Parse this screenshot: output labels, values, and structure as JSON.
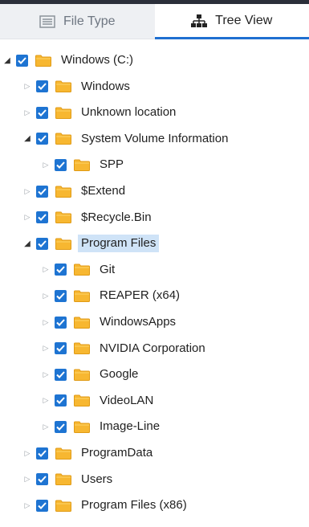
{
  "tabs": [
    {
      "label": "File Type",
      "icon": "list-icon",
      "active": false
    },
    {
      "label": "Tree View",
      "icon": "tree-icon",
      "active": true
    }
  ],
  "colors": {
    "accent": "#1e74d2",
    "folder": "#f7b731",
    "selection": "#cfe3f7"
  },
  "tree": [
    {
      "label": "Windows (C:)",
      "level": 0,
      "expanded": true,
      "checked": true
    },
    {
      "label": "Windows",
      "level": 1,
      "expanded": false,
      "checked": true
    },
    {
      "label": "Unknown location",
      "level": 1,
      "expanded": false,
      "checked": true
    },
    {
      "label": "System Volume Information",
      "level": 1,
      "expanded": true,
      "checked": true
    },
    {
      "label": "SPP",
      "level": 2,
      "expanded": false,
      "checked": true
    },
    {
      "label": "$Extend",
      "level": 1,
      "expanded": false,
      "checked": true
    },
    {
      "label": "$Recycle.Bin",
      "level": 1,
      "expanded": false,
      "checked": true
    },
    {
      "label": "Program Files",
      "level": 1,
      "expanded": true,
      "checked": true,
      "selected": true
    },
    {
      "label": "Git",
      "level": 2,
      "expanded": false,
      "checked": true
    },
    {
      "label": "REAPER (x64)",
      "level": 2,
      "expanded": false,
      "checked": true
    },
    {
      "label": "WindowsApps",
      "level": 2,
      "expanded": false,
      "checked": true
    },
    {
      "label": "NVIDIA Corporation",
      "level": 2,
      "expanded": false,
      "checked": true
    },
    {
      "label": "Google",
      "level": 2,
      "expanded": false,
      "checked": true
    },
    {
      "label": "VideoLAN",
      "level": 2,
      "expanded": false,
      "checked": true
    },
    {
      "label": "Image-Line",
      "level": 2,
      "expanded": false,
      "checked": true
    },
    {
      "label": "ProgramData",
      "level": 1,
      "expanded": false,
      "checked": true
    },
    {
      "label": "Users",
      "level": 1,
      "expanded": false,
      "checked": true
    },
    {
      "label": "Program Files (x86)",
      "level": 1,
      "expanded": false,
      "checked": true
    }
  ]
}
